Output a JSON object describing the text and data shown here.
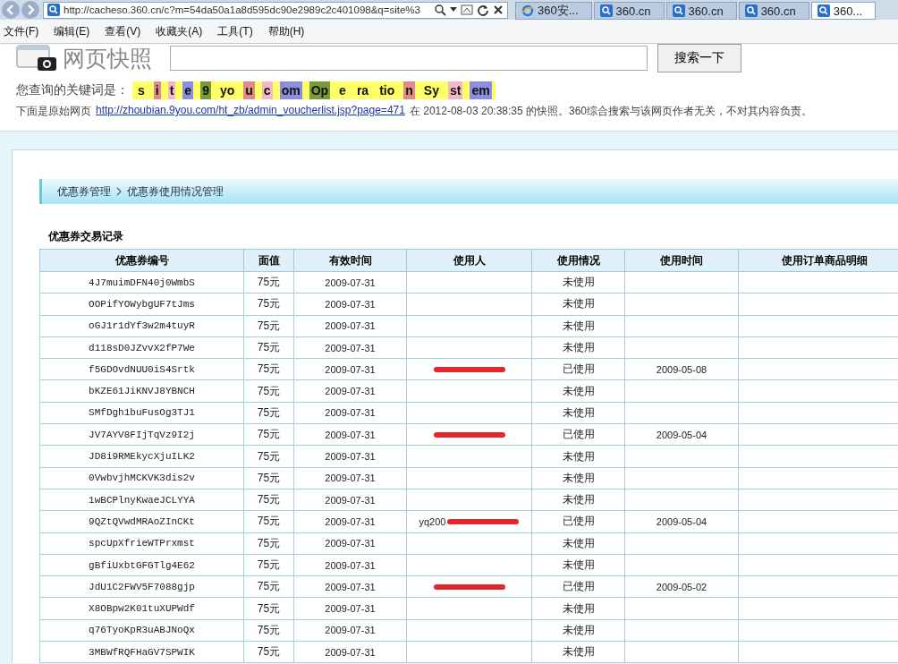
{
  "browser": {
    "address": "http://cacheso.360.cn/c?m=54da50a1a8d595dc90e2989c2c401098&q=site%3",
    "tabs": [
      {
        "label": "360安...",
        "kind": "ie",
        "selected": false
      },
      {
        "label": "360.cn",
        "kind": "search",
        "selected": false
      },
      {
        "label": "360.cn",
        "kind": "search",
        "selected": false
      },
      {
        "label": "360.cn",
        "kind": "search",
        "selected": false
      },
      {
        "label": "360...",
        "kind": "search",
        "selected": true
      }
    ],
    "menu": [
      "文件(F)",
      "编辑(E)",
      "查看(V)",
      "收藏夹(A)",
      "工具(T)",
      "帮助(H)"
    ]
  },
  "snapshot": {
    "logo": "网页快照",
    "search_button": "搜索一下",
    "keyword_label": "您查询的关键词是：",
    "keywords": [
      {
        "text": "s",
        "color": "#ffff66"
      },
      {
        "text": "i",
        "color": "#e08a8a"
      },
      {
        "text": "t",
        "color": "#f2b8c6"
      },
      {
        "text": "e",
        "color": "#8c8ce0"
      },
      {
        "text": "9",
        "color": "#7a9a3a"
      },
      {
        "text": "yo",
        "color": "#ffff66"
      },
      {
        "text": "u",
        "color": "#e08a8a"
      },
      {
        "text": "c",
        "color": "#f2b8c6"
      },
      {
        "text": "om",
        "color": "#8c8ce0"
      },
      {
        "text": "Op",
        "color": "#7a9a3a"
      },
      {
        "text": "e",
        "color": "#ffff66"
      },
      {
        "text": "ra",
        "color": "#ffff66"
      },
      {
        "text": "tio",
        "color": "#ffff66"
      },
      {
        "text": "n",
        "color": "#e08a8a"
      },
      {
        "text": "Sy",
        "color": "#ffff66"
      },
      {
        "text": "st",
        "color": "#f2b8c6"
      },
      {
        "text": "em",
        "color": "#8c8ce0"
      }
    ],
    "source_prefix": "下面是原始网页",
    "source_link": "http://zhoubian.9you.com/ht_zb/admin_voucherlist.jsp?page=471",
    "source_suffix": "在 2012-08-03 20:38:35 的快照。360综合搜索与该网页作者无关，不对其内容负责。"
  },
  "page": {
    "breadcrumb": [
      "优惠券管理",
      "优惠券使用情况管理"
    ],
    "section_title": "优惠券交易记录",
    "table": {
      "columns": [
        "优惠券编号",
        "面值",
        "有效时间",
        "使用人",
        "使用情况",
        "使用时间",
        "使用订单商品明细"
      ],
      "rows": [
        {
          "code": "4J7muimDFN40j0WmbS",
          "value": "75元",
          "valid": "2009-07-31",
          "status": "未使用"
        },
        {
          "code": "OOPifYOWybgUF7tJms",
          "value": "75元",
          "valid": "2009-07-31",
          "status": "未使用"
        },
        {
          "code": "oGJ1r1dYf3w2m4tuyR",
          "value": "75元",
          "valid": "2009-07-31",
          "status": "未使用"
        },
        {
          "code": "d118sD0JZvvX2fP7We",
          "value": "75元",
          "valid": "2009-07-31",
          "status": "未使用"
        },
        {
          "code": "f5GDOvdNUU0iS4Srtk",
          "value": "75元",
          "valid": "2009-07-31",
          "redacted": true,
          "status": "已使用",
          "used_at": "2009-05-08"
        },
        {
          "code": "bKZE61JiKNVJ8YBNCH",
          "value": "75元",
          "valid": "2009-07-31",
          "status": "未使用"
        },
        {
          "code": "SMfDgh1buFusOg3TJ1",
          "value": "75元",
          "valid": "2009-07-31",
          "status": "未使用"
        },
        {
          "code": "JV7AYV8FIjTqVz9I2j",
          "value": "75元",
          "valid": "2009-07-31",
          "redacted": true,
          "status": "已使用",
          "used_at": "2009-05-04"
        },
        {
          "code": "JD8i9RMEkycXjuILK2",
          "value": "75元",
          "valid": "2009-07-31",
          "status": "未使用"
        },
        {
          "code": "0VwbvjhMCKVK3dis2v",
          "value": "75元",
          "valid": "2009-07-31",
          "status": "未使用"
        },
        {
          "code": "1wBCPlnyKwaeJCLYYA",
          "value": "75元",
          "valid": "2009-07-31",
          "status": "未使用"
        },
        {
          "code": "9QZtQVwdMRAoZInCKt",
          "value": "75元",
          "valid": "2009-07-31",
          "user": "yq200",
          "redacted": true,
          "status": "已使用",
          "used_at": "2009-05-04"
        },
        {
          "code": "spcUpXfrieWTPrxmst",
          "value": "75元",
          "valid": "2009-07-31",
          "status": "未使用"
        },
        {
          "code": "gBfiUxbtGFGTlg4E62",
          "value": "75元",
          "valid": "2009-07-31",
          "status": "未使用"
        },
        {
          "code": "JdU1C2FWV5F7088gjp",
          "value": "75元",
          "valid": "2009-07-31",
          "redacted": true,
          "status": "已使用",
          "used_at": "2009-05-02"
        },
        {
          "code": "X8OBpw2K01tuXUPWdf",
          "value": "75元",
          "valid": "2009-07-31",
          "status": "未使用"
        },
        {
          "code": "q76TyoKpR3uABJNoQx",
          "value": "75元",
          "valid": "2009-07-31",
          "status": "未使用"
        },
        {
          "code": "3MBWfRQFHaGV7SPWIK",
          "value": "75元",
          "valid": "2009-07-31",
          "status": "未使用"
        }
      ]
    }
  }
}
